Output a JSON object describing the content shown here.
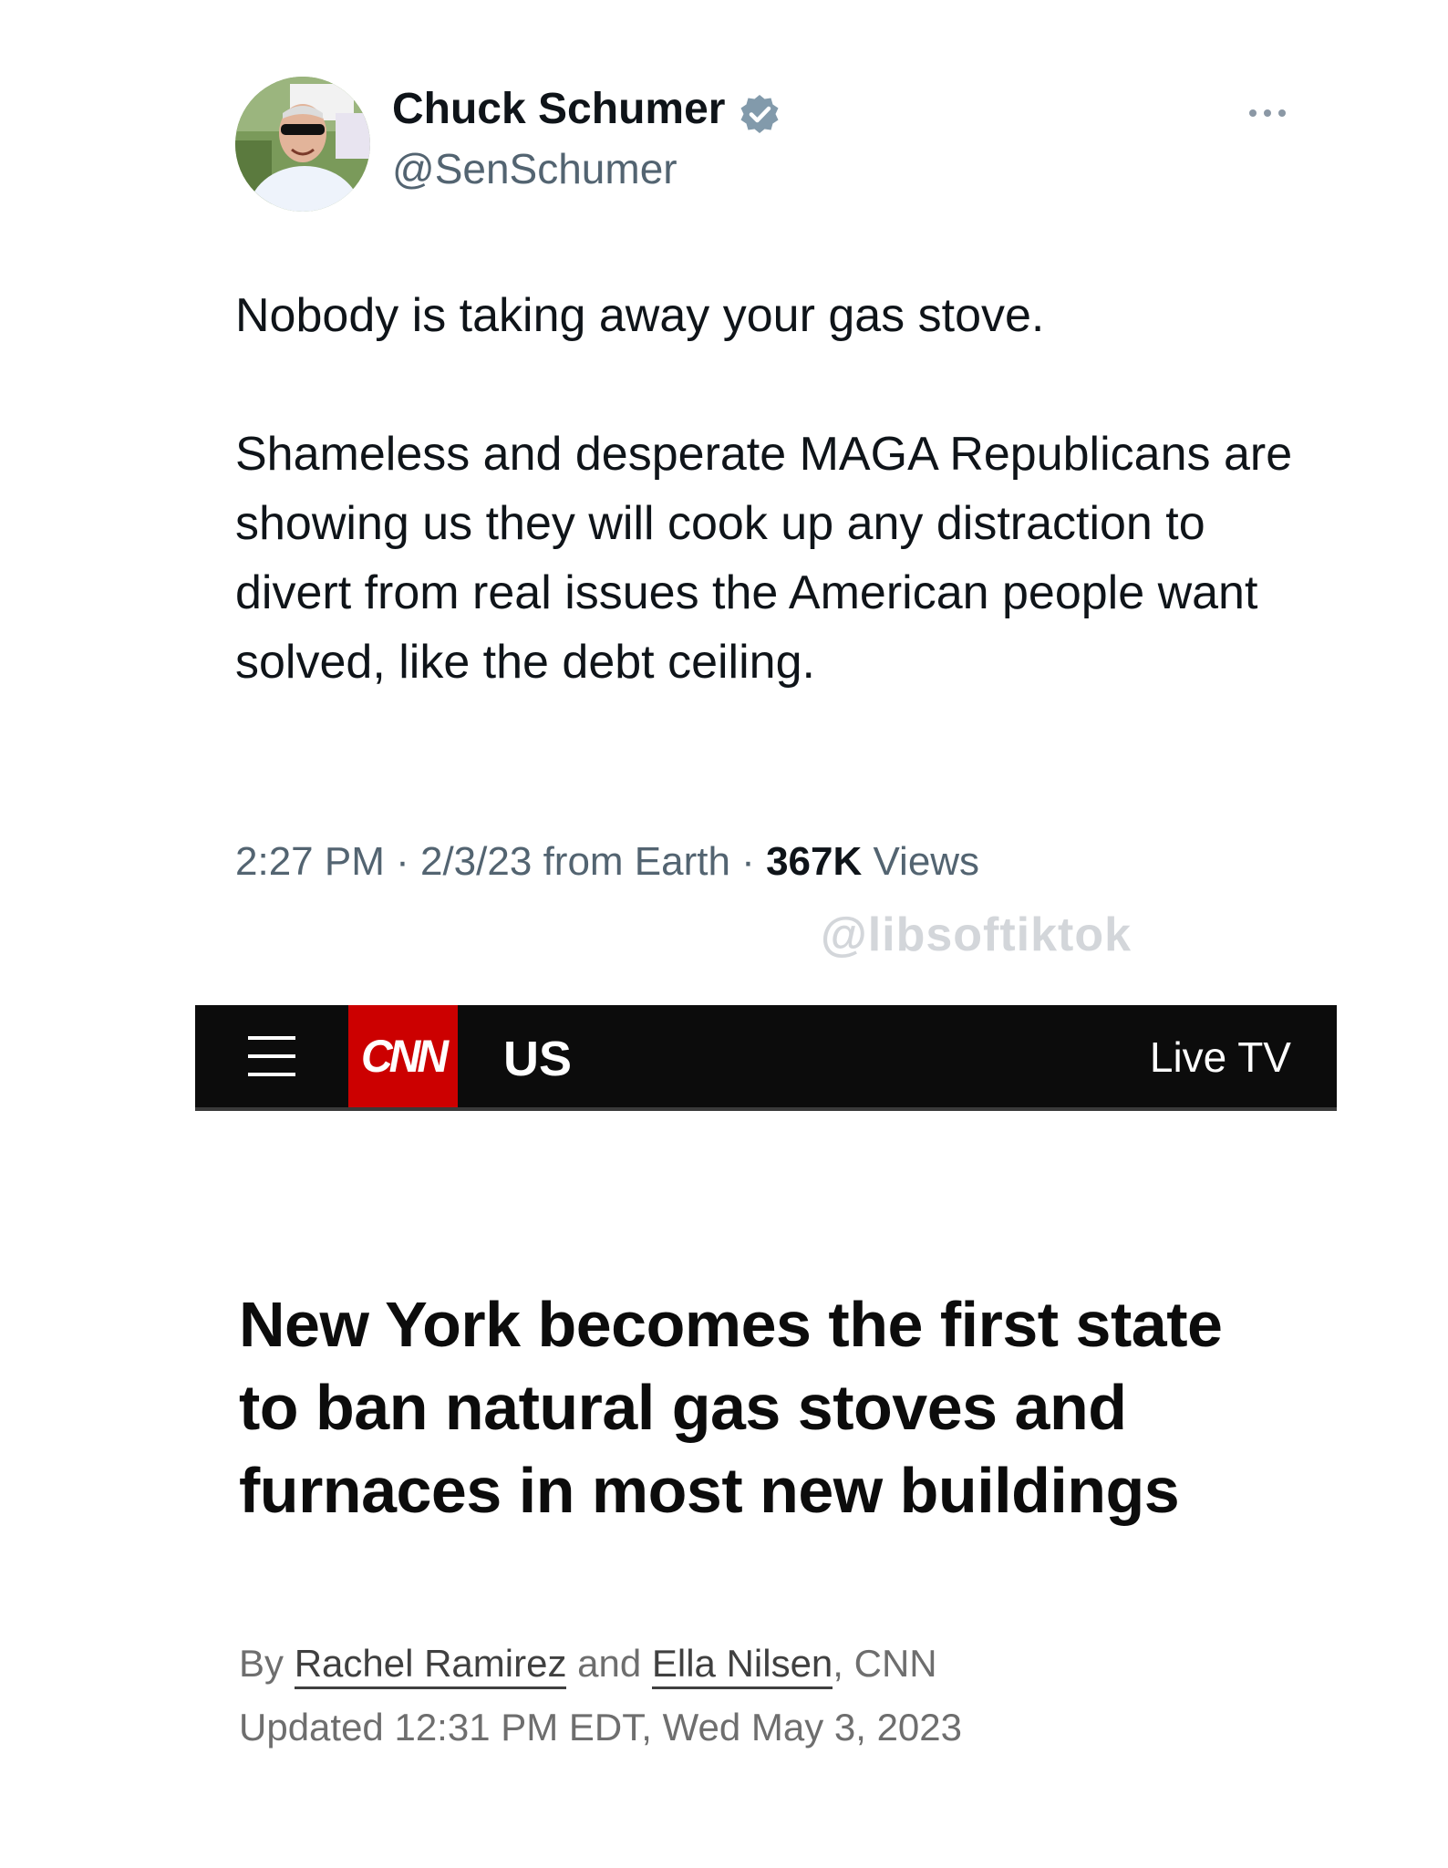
{
  "tweet": {
    "author_name": "Chuck Schumer",
    "author_handle": "@SenSchumer",
    "paragraph1": "Nobody is taking away your gas stove.",
    "paragraph2": "Shameless and desperate MAGA Republicans are showing us they will cook up any distraction to divert from real issues the American people want solved, like the debt ceiling.",
    "time": "2:27 PM",
    "date": "2/3/23",
    "source": "from Earth",
    "views_count": "367K",
    "views_label": "Views",
    "sep": " · "
  },
  "watermark": "@libsoftiktok",
  "icons": {
    "verified": "verified-badge-icon",
    "more": "more-options-icon",
    "menu": "hamburger-menu-icon"
  },
  "colors": {
    "cnn_red": "#cc0000",
    "verified_badge": "#829aab",
    "bar_bg": "#0c0c0c"
  },
  "cnn": {
    "logo_text": "CNN",
    "section": "US",
    "live_tv": "Live TV"
  },
  "article": {
    "headline": "New York becomes the first state to ban natural gas stoves and furnaces in most new buildings",
    "by": "By",
    "author1": "Rachel Ramirez",
    "and": "and",
    "author2": "Ella Nilsen",
    "outlet": ", CNN",
    "updated": "Updated 12:31 PM EDT, Wed May 3, 2023"
  }
}
